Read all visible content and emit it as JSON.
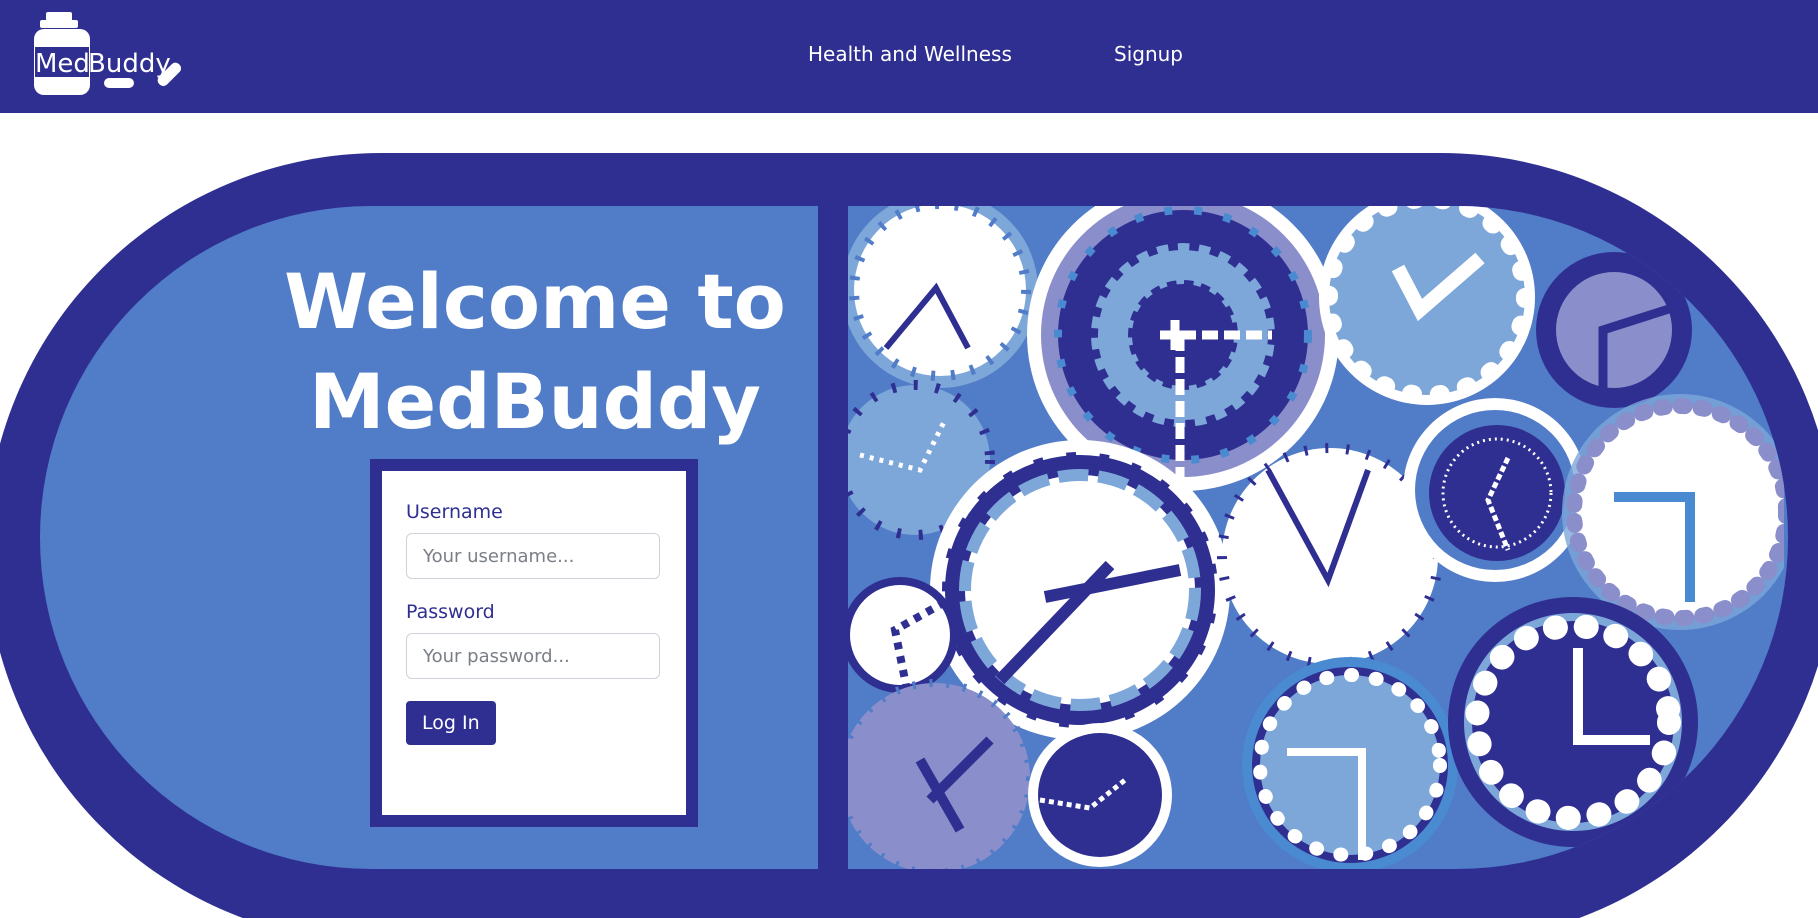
{
  "brand": {
    "logo_text_part1": "Med",
    "logo_text_part2": "Buddy"
  },
  "nav": {
    "links": [
      {
        "label": "Health and Wellness"
      },
      {
        "label": "Signup"
      }
    ]
  },
  "hero": {
    "title_line1": "Welcome to",
    "title_line2": "MedBuddy"
  },
  "login_form": {
    "username_label": "Username",
    "username_placeholder": "Your username...",
    "password_label": "Password",
    "password_placeholder": "Your password...",
    "submit_label": "Log In"
  },
  "colors": {
    "navy": "#2f2f92",
    "blue": "#507cc8",
    "light_blue": "#7da6d9",
    "lavender": "#8a8fcb",
    "white": "#ffffff"
  }
}
